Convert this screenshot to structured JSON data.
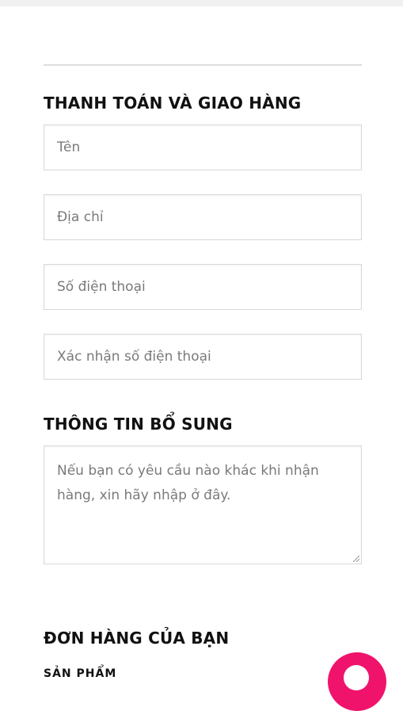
{
  "checkout": {
    "billing_title": "THANH TOÁN VÀ GIAO HÀNG",
    "fields": {
      "name_placeholder": "Tên",
      "address_placeholder": "Địa chỉ",
      "phone_placeholder": "Số điện thoại",
      "phone_confirm_placeholder": "Xác nhận số điện thoại"
    },
    "additional_title": "THÔNG TIN BỔ SUNG",
    "notes_placeholder": "Nếu bạn có yêu cầu nào khác khi nhận hàng, xin hãy nhập ở đây.",
    "order_title": "ĐƠN HÀNG CỦA BẠN",
    "order_column_partial": "SẢN PHẨM"
  },
  "colors": {
    "accent": "#f0136c",
    "border": "#d9d9d9",
    "placeholder": "#7a7a7a"
  },
  "icons": {
    "chat_button": "chat-bubble-icon"
  }
}
